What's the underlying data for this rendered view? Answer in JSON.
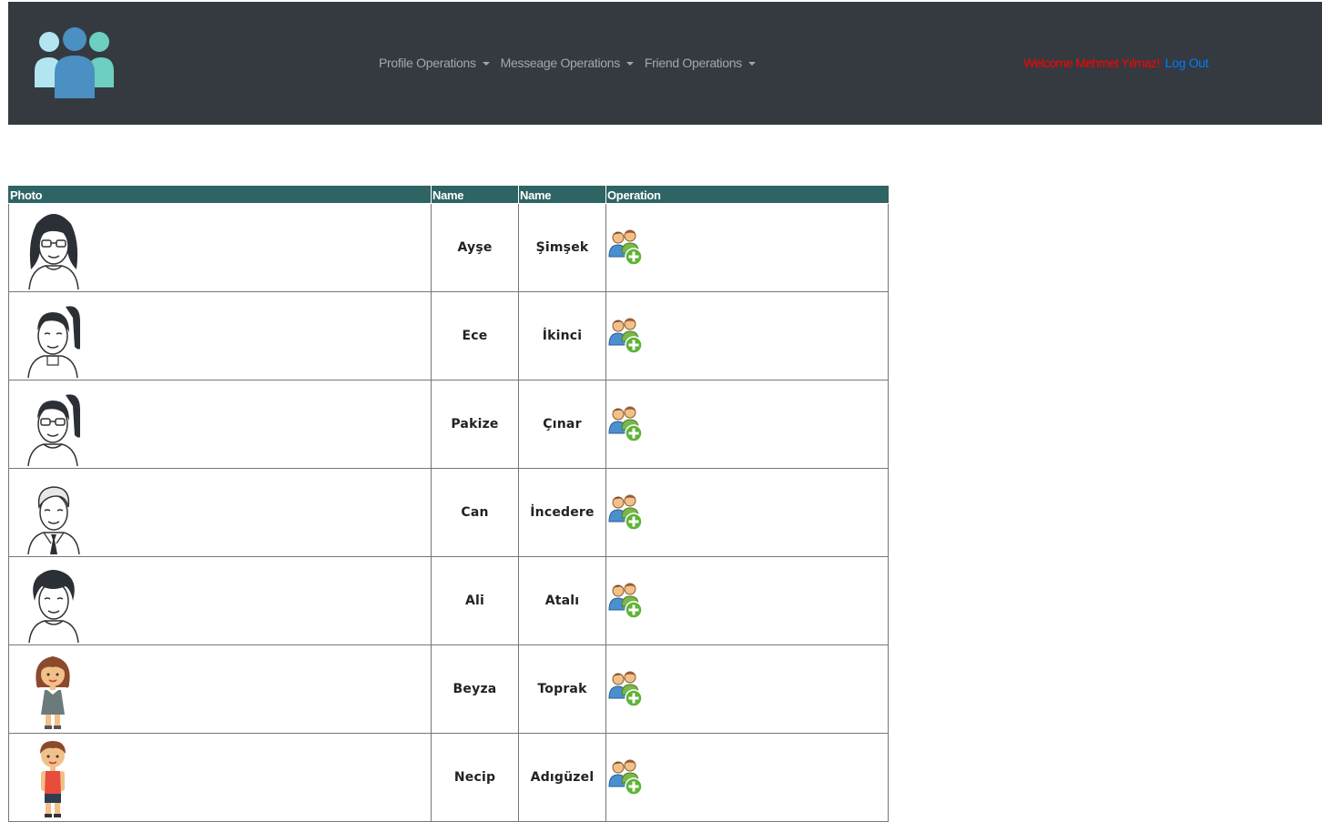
{
  "nav": {
    "menus": [
      {
        "label": "Profile Operations"
      },
      {
        "label": "Messeage Operations"
      },
      {
        "label": "Friend Operations"
      }
    ],
    "welcome": "Welcome Mehmet Yılmaz!",
    "logout": "Log Out"
  },
  "table": {
    "headers": [
      "Photo",
      "Name",
      "Name",
      "Operation"
    ],
    "rows": [
      {
        "first": "Ayşe",
        "last": "Şimşek",
        "avatar": "woman-glasses-avatar-icon"
      },
      {
        "first": "Ece",
        "last": "İkinci",
        "avatar": "woman-ponytail-avatar-icon"
      },
      {
        "first": "Pakize",
        "last": "Çınar",
        "avatar": "woman-ponytail-glasses-avatar-icon"
      },
      {
        "first": "Can",
        "last": "İncedere",
        "avatar": "man-tie-avatar-icon"
      },
      {
        "first": "Ali",
        "last": "Atalı",
        "avatar": "man-curly-avatar-icon"
      },
      {
        "first": "Beyza",
        "last": "Toprak",
        "avatar": "girl-dress-avatar-icon"
      },
      {
        "first": "Necip",
        "last": "Adıgüzel",
        "avatar": "boy-tanktop-avatar-icon"
      }
    ]
  },
  "colors": {
    "navbar": "#343a40",
    "header": "#2f6464",
    "welcome": "#ff0000",
    "link": "#007bff"
  }
}
